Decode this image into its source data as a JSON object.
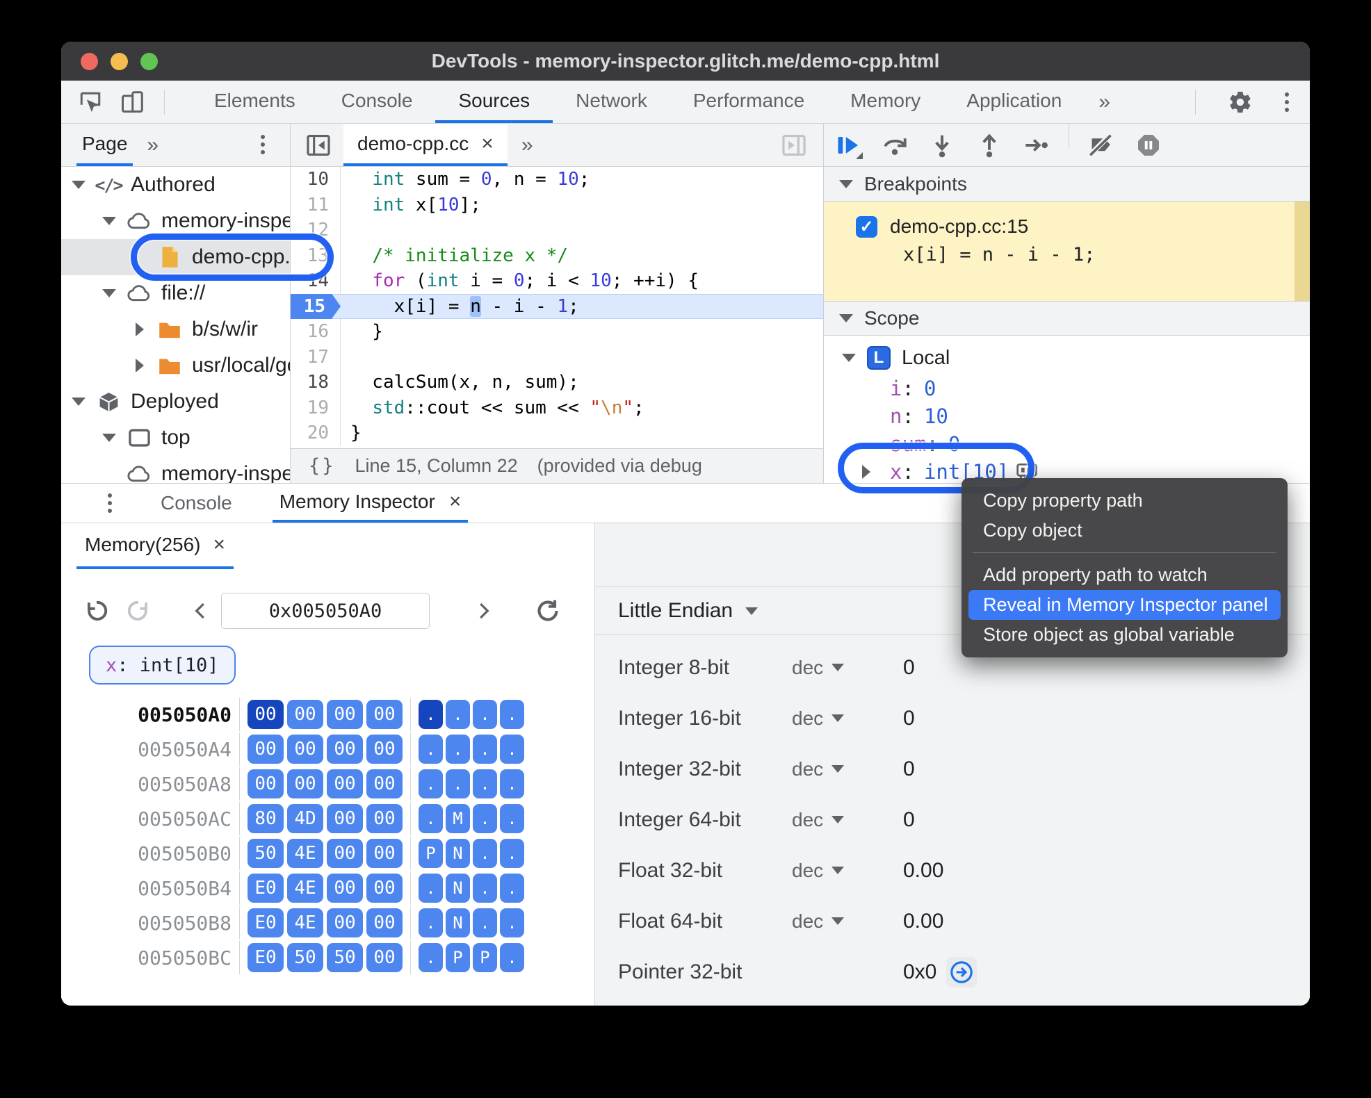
{
  "window": {
    "title": "DevTools - memory-inspector.glitch.me/demo-cpp.html"
  },
  "toolbar": {
    "tabs": [
      "Elements",
      "Console",
      "Sources",
      "Network",
      "Performance",
      "Memory",
      "Application"
    ],
    "active_tab": "Sources",
    "more_label": "»"
  },
  "navigator": {
    "tab_label": "Page",
    "more_label": "»",
    "tree": [
      {
        "label": "Authored",
        "icon": "code",
        "arrow": "down",
        "depth": 0
      },
      {
        "label": "memory-inspector.glit",
        "icon": "cloud",
        "arrow": "down",
        "depth": 1
      },
      {
        "label": "demo-cpp.cc",
        "icon": "file",
        "arrow": "none",
        "depth": 2,
        "selected": true
      },
      {
        "label": "file://",
        "icon": "cloud",
        "arrow": "down",
        "depth": 1
      },
      {
        "label": "b/s/w/ir",
        "icon": "folder",
        "arrow": "right",
        "depth": 2
      },
      {
        "label": "usr/local/google/ho",
        "icon": "folder",
        "arrow": "right",
        "depth": 2
      },
      {
        "label": "Deployed",
        "icon": "package",
        "arrow": "down",
        "depth": 0
      },
      {
        "label": "top",
        "icon": "frame",
        "arrow": "down",
        "depth": 1
      },
      {
        "label": "memory-inspector.glitch.me",
        "icon": "cloud",
        "arrow": "none",
        "depth": 1,
        "partial": true
      }
    ]
  },
  "editor": {
    "tab_label": "demo-cpp.cc",
    "tab_close": "×",
    "more_label": "»",
    "lines": [
      {
        "no": "10",
        "g": "dark",
        "tokens": [
          [
            "  ",
            ""
          ],
          [
            "int",
            "t"
          ],
          [
            " sum = ",
            ""
          ],
          [
            "0",
            "n"
          ],
          [
            ", n = ",
            ""
          ],
          [
            "10",
            "n"
          ],
          [
            ";",
            ""
          ]
        ]
      },
      {
        "no": "11",
        "g": "dim",
        "tokens": [
          [
            "  ",
            ""
          ],
          [
            "int",
            "t"
          ],
          [
            " x[",
            ""
          ],
          [
            "10",
            "n"
          ],
          [
            "];",
            ""
          ]
        ]
      },
      {
        "no": "12",
        "g": "dim",
        "tokens": []
      },
      {
        "no": "13",
        "g": "dim",
        "tokens": [
          [
            "  ",
            ""
          ],
          [
            "/* initialize x */",
            "c"
          ]
        ]
      },
      {
        "no": "14",
        "g": "dark",
        "tokens": [
          [
            "  ",
            ""
          ],
          [
            "for",
            "k"
          ],
          [
            " (",
            ""
          ],
          [
            "int",
            "t"
          ],
          [
            " i = ",
            ""
          ],
          [
            "0",
            "n"
          ],
          [
            "; i < ",
            ""
          ],
          [
            "10",
            "n"
          ],
          [
            "; ++i) {",
            ""
          ]
        ]
      },
      {
        "no": "15",
        "g": "exec",
        "tokens": [
          [
            "    x[i] = ",
            ""
          ],
          [
            "n",
            "hl"
          ],
          [
            " - i - ",
            ""
          ],
          [
            "1",
            "n"
          ],
          [
            ";",
            ""
          ]
        ]
      },
      {
        "no": "16",
        "g": "dim",
        "tokens": [
          [
            "  }",
            ""
          ]
        ]
      },
      {
        "no": "17",
        "g": "dim",
        "tokens": []
      },
      {
        "no": "18",
        "g": "dark",
        "tokens": [
          [
            "  calcSum(x, n, sum);",
            ""
          ]
        ]
      },
      {
        "no": "19",
        "g": "dim",
        "tokens": [
          [
            "  ",
            ""
          ],
          [
            "std",
            "t"
          ],
          [
            "::cout << sum << ",
            ""
          ],
          [
            "\"",
            "s"
          ],
          [
            "\\n",
            "e"
          ],
          [
            "\"",
            "s"
          ],
          [
            ";",
            ""
          ]
        ]
      },
      {
        "no": "20",
        "g": "dim",
        "tokens": [
          [
            "}",
            ""
          ]
        ]
      }
    ],
    "status_icon": "{}",
    "status_text": "Line 15, Column 22",
    "status_extra": "(provided via debug"
  },
  "debugger": {
    "breakpoints_title": "Breakpoints",
    "breakpoint": {
      "checked": true,
      "label": "demo-cpp.cc:15",
      "code": "x[i] = n - i - 1;"
    },
    "scope_title": "Scope",
    "scope_local": {
      "badge": "L",
      "label": "Local",
      "vars": [
        {
          "name": "i",
          "value": "0",
          "arrow": false
        },
        {
          "name": "n",
          "value": "10",
          "arrow": false
        },
        {
          "name": "sum",
          "value": "0",
          "arrow": false
        },
        {
          "name": "x",
          "value": "int[10]",
          "arrow": true,
          "memory_icon": true
        }
      ]
    }
  },
  "context_menu": {
    "items": [
      {
        "type": "item",
        "label": "Copy property path"
      },
      {
        "type": "item",
        "label": "Copy object"
      },
      {
        "type": "separator"
      },
      {
        "type": "item",
        "label": "Add property path to watch"
      },
      {
        "type": "item",
        "label": "Reveal in Memory Inspector panel",
        "highlighted": true
      },
      {
        "type": "item",
        "label": "Store object as global variable"
      }
    ]
  },
  "drawer": {
    "console_label": "Console",
    "memory_inspector_label": "Memory Inspector",
    "close_label": "×"
  },
  "memory_inspector": {
    "tab_label": "Memory(256)",
    "close_label": "×",
    "address_input": "0x005050A0",
    "chip": {
      "var": "x",
      "rest": ": int[10]"
    },
    "hex_rows": [
      {
        "addr": "005050A0",
        "bytes": [
          "00",
          "00",
          "00",
          "00"
        ],
        "ascii": [
          ".",
          ".",
          ".",
          "."
        ],
        "current": true
      },
      {
        "addr": "005050A4",
        "bytes": [
          "00",
          "00",
          "00",
          "00"
        ],
        "ascii": [
          ".",
          ".",
          ".",
          "."
        ]
      },
      {
        "addr": "005050A8",
        "bytes": [
          "00",
          "00",
          "00",
          "00"
        ],
        "ascii": [
          ".",
          ".",
          ".",
          "."
        ]
      },
      {
        "addr": "005050AC",
        "bytes": [
          "80",
          "4D",
          "00",
          "00"
        ],
        "ascii": [
          ".",
          "M",
          ".",
          "."
        ]
      },
      {
        "addr": "005050B0",
        "bytes": [
          "50",
          "4E",
          "00",
          "00"
        ],
        "ascii": [
          "P",
          "N",
          ".",
          "."
        ]
      },
      {
        "addr": "005050B4",
        "bytes": [
          "E0",
          "4E",
          "00",
          "00"
        ],
        "ascii": [
          ".",
          "N",
          ".",
          "."
        ]
      },
      {
        "addr": "005050B8",
        "bytes": [
          "E0",
          "4E",
          "00",
          "00"
        ],
        "ascii": [
          ".",
          "N",
          ".",
          "."
        ]
      },
      {
        "addr": "005050BC",
        "bytes": [
          "E0",
          "50",
          "50",
          "00"
        ],
        "ascii": [
          ".",
          "P",
          "P",
          "."
        ]
      }
    ],
    "interpreter": {
      "endianness": "Little Endian",
      "rows": [
        {
          "label": "Integer 8-bit",
          "mode": "dec",
          "value": "0"
        },
        {
          "label": "Integer 16-bit",
          "mode": "dec",
          "value": "0"
        },
        {
          "label": "Integer 32-bit",
          "mode": "dec",
          "value": "0"
        },
        {
          "label": "Integer 64-bit",
          "mode": "dec",
          "value": "0"
        },
        {
          "label": "Float 32-bit",
          "mode": "dec",
          "value": "0.00"
        },
        {
          "label": "Float 64-bit",
          "mode": "dec",
          "value": "0.00"
        },
        {
          "label": "Pointer 32-bit",
          "mode": "",
          "value": "0x0",
          "jump": true
        }
      ]
    }
  },
  "annotations": [
    {
      "target": "demo-cpp.cc tree item",
      "color": "#2160f3"
    },
    {
      "target": "x: int[10] scope variable",
      "color": "#2160f3"
    }
  ],
  "colors": {
    "accent_blue": "#1a73e8",
    "annotation_blue": "#2160f3",
    "breakpoint_yellow": "#fdf3c5",
    "hex_byte_blue": "#4e86ef",
    "hex_byte_selected": "#1646bd",
    "menu_highlight": "#3c79f5",
    "selection_gray": "#e2e4e7",
    "titlebar": "#3a3a3c"
  }
}
